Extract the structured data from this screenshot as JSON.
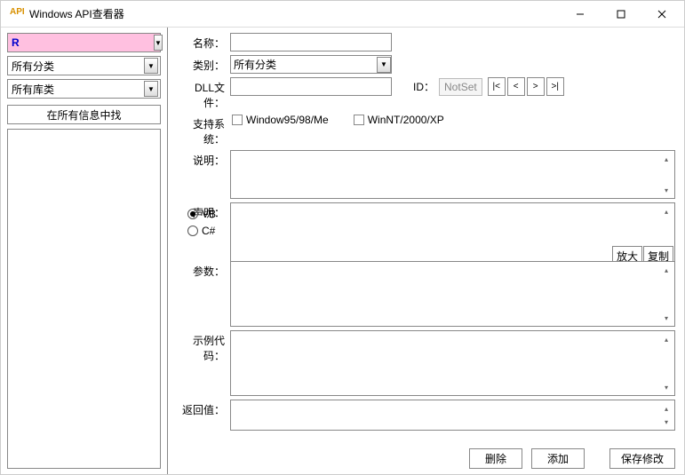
{
  "titlebar": {
    "title": "Windows API查看器",
    "icon_text": "API"
  },
  "sidebar": {
    "search_value": "R",
    "category_value": "所有分类",
    "library_value": "所有库类",
    "search_button": "在所有信息中找"
  },
  "fields": {
    "name_label": "名称：",
    "category_label": "类别：",
    "category_value": "所有分类",
    "dll_label": "DLL文件：",
    "id_label": "ID：",
    "id_value": "NotSet",
    "nav": {
      "first": "|<",
      "prev": "<",
      "next": ">",
      "last": ">|"
    },
    "support_label": "支持系统：",
    "support_win9x": "Window95/98/Me",
    "support_winnt": "WinNT/2000/XP",
    "desc_label": "说明：",
    "decl_label": "声明：",
    "radio_vb": "VB",
    "radio_cs": "C#",
    "zoom_btn": "放大",
    "copy_btn": "复制",
    "params_label": "参数：",
    "example_label": "示例代码：",
    "return_label": "返回值："
  },
  "buttons": {
    "delete": "删除",
    "add": "添加",
    "save": "保存修改"
  }
}
